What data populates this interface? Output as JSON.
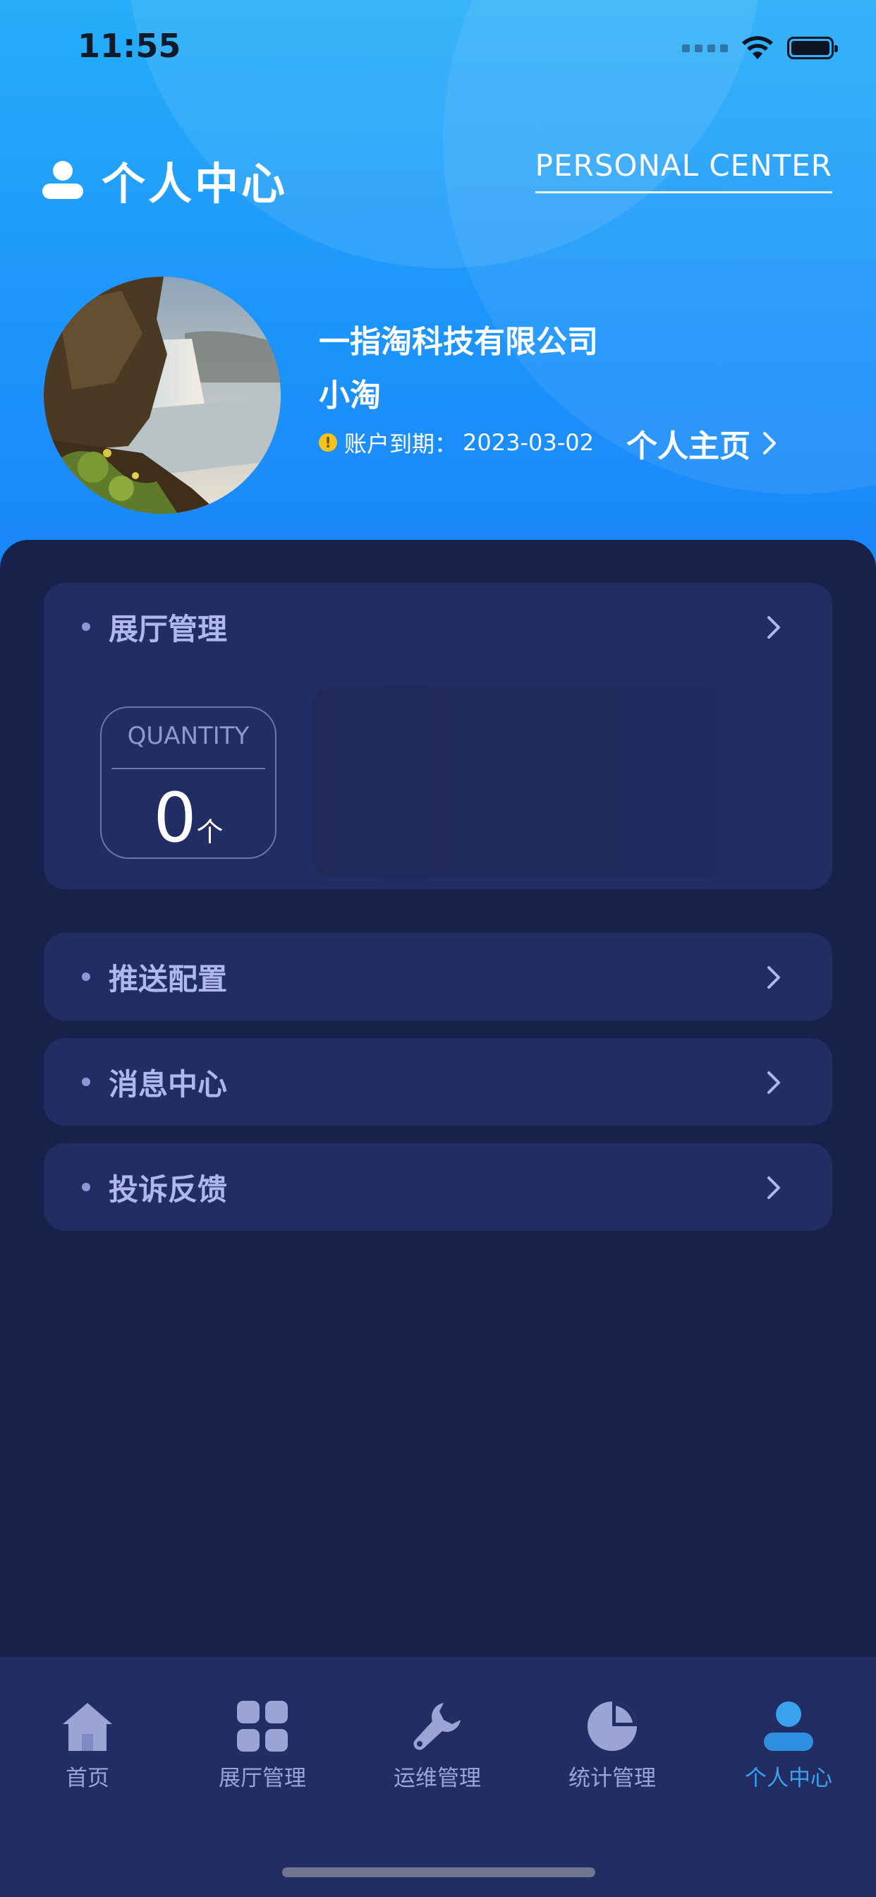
{
  "status_bar": {
    "time": "11:55"
  },
  "header": {
    "title": "个人中心",
    "title_en": "PERSONAL CENTER"
  },
  "profile": {
    "company": "一指淘科技有限公司",
    "username": "小淘",
    "expire_label": "账户到期：",
    "expire_date": "2023-03-02",
    "home_link": "个人主页",
    "avatar": "waterfall-landscape-photo"
  },
  "menu": {
    "hall": {
      "label": "展厅管理",
      "quantity_label": "QUANTITY",
      "quantity_value": "0",
      "quantity_unit": "个"
    },
    "items": [
      {
        "label": "推送配置"
      },
      {
        "label": "消息中心"
      },
      {
        "label": "投诉反馈"
      }
    ]
  },
  "tabbar": {
    "items": [
      {
        "label": "首页",
        "icon": "home-icon"
      },
      {
        "label": "展厅管理",
        "icon": "grid-icon"
      },
      {
        "label": "运维管理",
        "icon": "wrench-icon"
      },
      {
        "label": "统计管理",
        "icon": "pie-chart-icon"
      },
      {
        "label": "个人中心",
        "icon": "user-icon",
        "active": true
      }
    ]
  },
  "colors": {
    "header_gradient_top": "#26aef9",
    "header_gradient_bottom": "#1a86f8",
    "background": "#18214a",
    "card": "#222e63",
    "accent": "#3aa2ee",
    "warning": "#f6c21c"
  }
}
